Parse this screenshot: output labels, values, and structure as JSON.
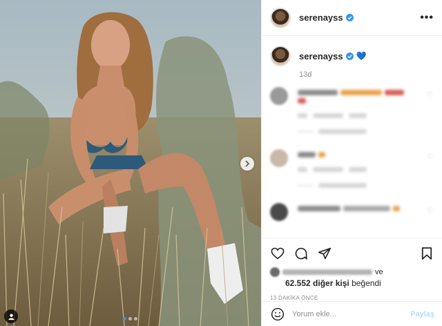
{
  "header": {
    "username": "serenayss",
    "more_label": "•••"
  },
  "caption": {
    "username": "serenayss",
    "emoji": "💙",
    "age": "13d"
  },
  "actions": {
    "liked_by_suffix": "ve",
    "likes_count": "62.552 diğer kişi",
    "likes_suffix": "beğendi",
    "timestamp": "13 DAKİKA ÖNCE"
  },
  "comment_box": {
    "placeholder": "Yorum ekle...",
    "share_label": "Paylaş"
  },
  "colors": {
    "verified": "#3897f0",
    "share_disabled": "#b2dffc",
    "heart_emoji": "#1c6fe0"
  },
  "icons": {
    "like": "heart-outline-icon",
    "comment": "comment-bubble-icon",
    "share": "paper-plane-icon",
    "save": "bookmark-icon",
    "emoji": "smiley-icon",
    "next": "chevron-right-icon",
    "tag": "user-tag-icon"
  }
}
